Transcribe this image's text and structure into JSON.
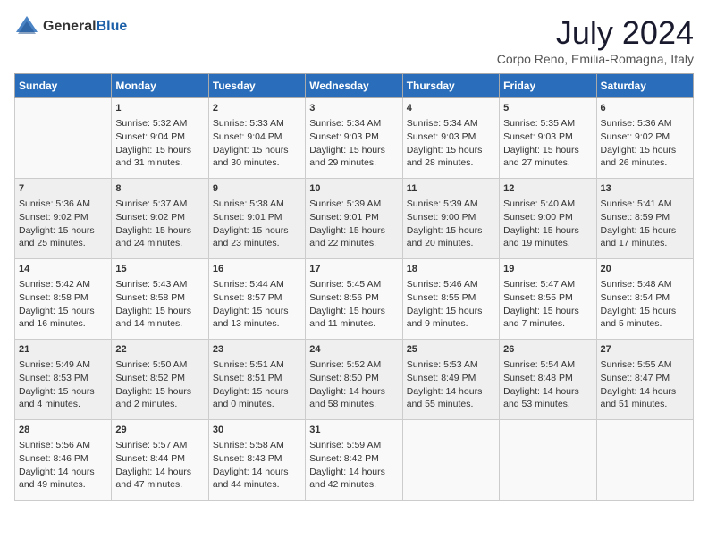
{
  "header": {
    "logo_general": "General",
    "logo_blue": "Blue",
    "month_year": "July 2024",
    "location": "Corpo Reno, Emilia-Romagna, Italy"
  },
  "days_of_week": [
    "Sunday",
    "Monday",
    "Tuesday",
    "Wednesday",
    "Thursday",
    "Friday",
    "Saturday"
  ],
  "weeks": [
    [
      {
        "day": "",
        "content": ""
      },
      {
        "day": "1",
        "content": "Sunrise: 5:32 AM\nSunset: 9:04 PM\nDaylight: 15 hours\nand 31 minutes."
      },
      {
        "day": "2",
        "content": "Sunrise: 5:33 AM\nSunset: 9:04 PM\nDaylight: 15 hours\nand 30 minutes."
      },
      {
        "day": "3",
        "content": "Sunrise: 5:34 AM\nSunset: 9:03 PM\nDaylight: 15 hours\nand 29 minutes."
      },
      {
        "day": "4",
        "content": "Sunrise: 5:34 AM\nSunset: 9:03 PM\nDaylight: 15 hours\nand 28 minutes."
      },
      {
        "day": "5",
        "content": "Sunrise: 5:35 AM\nSunset: 9:03 PM\nDaylight: 15 hours\nand 27 minutes."
      },
      {
        "day": "6",
        "content": "Sunrise: 5:36 AM\nSunset: 9:02 PM\nDaylight: 15 hours\nand 26 minutes."
      }
    ],
    [
      {
        "day": "7",
        "content": "Sunrise: 5:36 AM\nSunset: 9:02 PM\nDaylight: 15 hours\nand 25 minutes."
      },
      {
        "day": "8",
        "content": "Sunrise: 5:37 AM\nSunset: 9:02 PM\nDaylight: 15 hours\nand 24 minutes."
      },
      {
        "day": "9",
        "content": "Sunrise: 5:38 AM\nSunset: 9:01 PM\nDaylight: 15 hours\nand 23 minutes."
      },
      {
        "day": "10",
        "content": "Sunrise: 5:39 AM\nSunset: 9:01 PM\nDaylight: 15 hours\nand 22 minutes."
      },
      {
        "day": "11",
        "content": "Sunrise: 5:39 AM\nSunset: 9:00 PM\nDaylight: 15 hours\nand 20 minutes."
      },
      {
        "day": "12",
        "content": "Sunrise: 5:40 AM\nSunset: 9:00 PM\nDaylight: 15 hours\nand 19 minutes."
      },
      {
        "day": "13",
        "content": "Sunrise: 5:41 AM\nSunset: 8:59 PM\nDaylight: 15 hours\nand 17 minutes."
      }
    ],
    [
      {
        "day": "14",
        "content": "Sunrise: 5:42 AM\nSunset: 8:58 PM\nDaylight: 15 hours\nand 16 minutes."
      },
      {
        "day": "15",
        "content": "Sunrise: 5:43 AM\nSunset: 8:58 PM\nDaylight: 15 hours\nand 14 minutes."
      },
      {
        "day": "16",
        "content": "Sunrise: 5:44 AM\nSunset: 8:57 PM\nDaylight: 15 hours\nand 13 minutes."
      },
      {
        "day": "17",
        "content": "Sunrise: 5:45 AM\nSunset: 8:56 PM\nDaylight: 15 hours\nand 11 minutes."
      },
      {
        "day": "18",
        "content": "Sunrise: 5:46 AM\nSunset: 8:55 PM\nDaylight: 15 hours\nand 9 minutes."
      },
      {
        "day": "19",
        "content": "Sunrise: 5:47 AM\nSunset: 8:55 PM\nDaylight: 15 hours\nand 7 minutes."
      },
      {
        "day": "20",
        "content": "Sunrise: 5:48 AM\nSunset: 8:54 PM\nDaylight: 15 hours\nand 5 minutes."
      }
    ],
    [
      {
        "day": "21",
        "content": "Sunrise: 5:49 AM\nSunset: 8:53 PM\nDaylight: 15 hours\nand 4 minutes."
      },
      {
        "day": "22",
        "content": "Sunrise: 5:50 AM\nSunset: 8:52 PM\nDaylight: 15 hours\nand 2 minutes."
      },
      {
        "day": "23",
        "content": "Sunrise: 5:51 AM\nSunset: 8:51 PM\nDaylight: 15 hours\nand 0 minutes."
      },
      {
        "day": "24",
        "content": "Sunrise: 5:52 AM\nSunset: 8:50 PM\nDaylight: 14 hours\nand 58 minutes."
      },
      {
        "day": "25",
        "content": "Sunrise: 5:53 AM\nSunset: 8:49 PM\nDaylight: 14 hours\nand 55 minutes."
      },
      {
        "day": "26",
        "content": "Sunrise: 5:54 AM\nSunset: 8:48 PM\nDaylight: 14 hours\nand 53 minutes."
      },
      {
        "day": "27",
        "content": "Sunrise: 5:55 AM\nSunset: 8:47 PM\nDaylight: 14 hours\nand 51 minutes."
      }
    ],
    [
      {
        "day": "28",
        "content": "Sunrise: 5:56 AM\nSunset: 8:46 PM\nDaylight: 14 hours\nand 49 minutes."
      },
      {
        "day": "29",
        "content": "Sunrise: 5:57 AM\nSunset: 8:44 PM\nDaylight: 14 hours\nand 47 minutes."
      },
      {
        "day": "30",
        "content": "Sunrise: 5:58 AM\nSunset: 8:43 PM\nDaylight: 14 hours\nand 44 minutes."
      },
      {
        "day": "31",
        "content": "Sunrise: 5:59 AM\nSunset: 8:42 PM\nDaylight: 14 hours\nand 42 minutes."
      },
      {
        "day": "",
        "content": ""
      },
      {
        "day": "",
        "content": ""
      },
      {
        "day": "",
        "content": ""
      }
    ]
  ]
}
